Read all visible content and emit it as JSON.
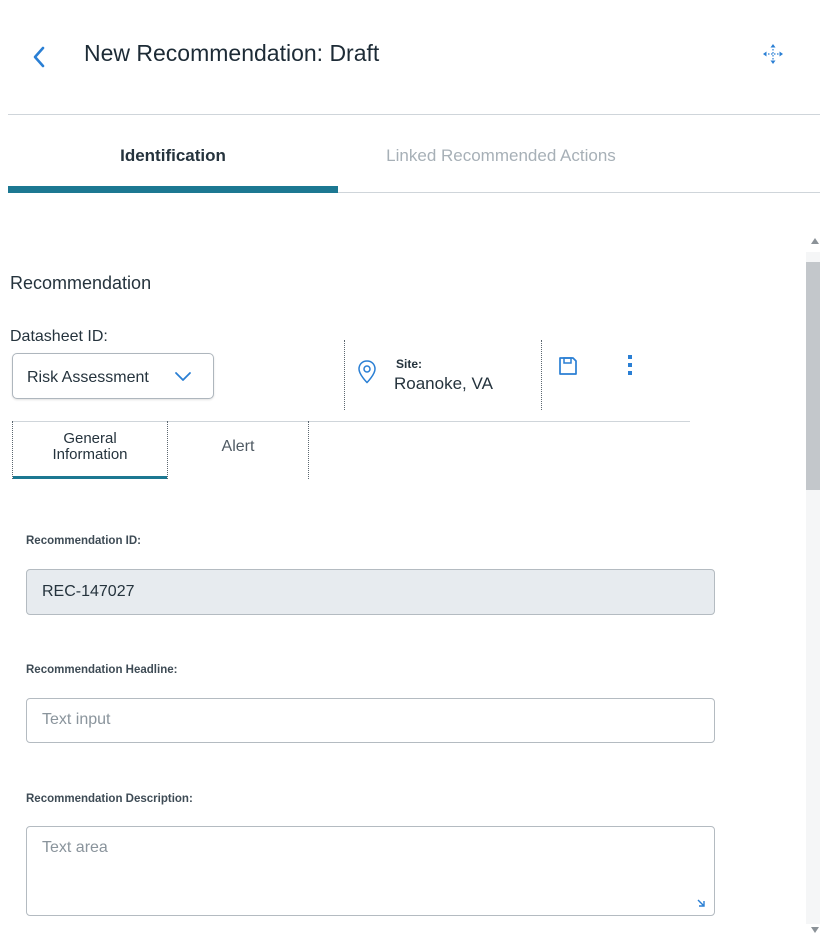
{
  "header": {
    "title": "New Recommendation: Draft"
  },
  "tabs": [
    {
      "label": "Identification",
      "active": true
    },
    {
      "label": "Linked Recommended Actions",
      "active": false
    }
  ],
  "section": {
    "title": "Recommendation"
  },
  "datasheet": {
    "label": "Datasheet ID:",
    "value": "Risk Assessment"
  },
  "site": {
    "label": "Site:",
    "value": "Roanoke, VA"
  },
  "subtabs": [
    {
      "label": "General\nInformation",
      "active": true
    },
    {
      "label": "Alert",
      "active": false
    }
  ],
  "fields": {
    "rec_id": {
      "label": "Recommendation ID:",
      "value": "REC-147027"
    },
    "headline": {
      "label": "Recommendation Headline:",
      "placeholder": "Text input"
    },
    "description": {
      "label": "Recommendation Description:",
      "placeholder": "Text area"
    }
  },
  "colors": {
    "accent": "#1c7892",
    "link_blue": "#2a7fd4",
    "readonly_bg": "#e7ebef"
  },
  "icons": [
    "back-chevron-icon",
    "move-icon",
    "chevron-down-icon",
    "location-pin-icon",
    "save-icon",
    "more-vertical-icon",
    "resize-handle-icon"
  ]
}
